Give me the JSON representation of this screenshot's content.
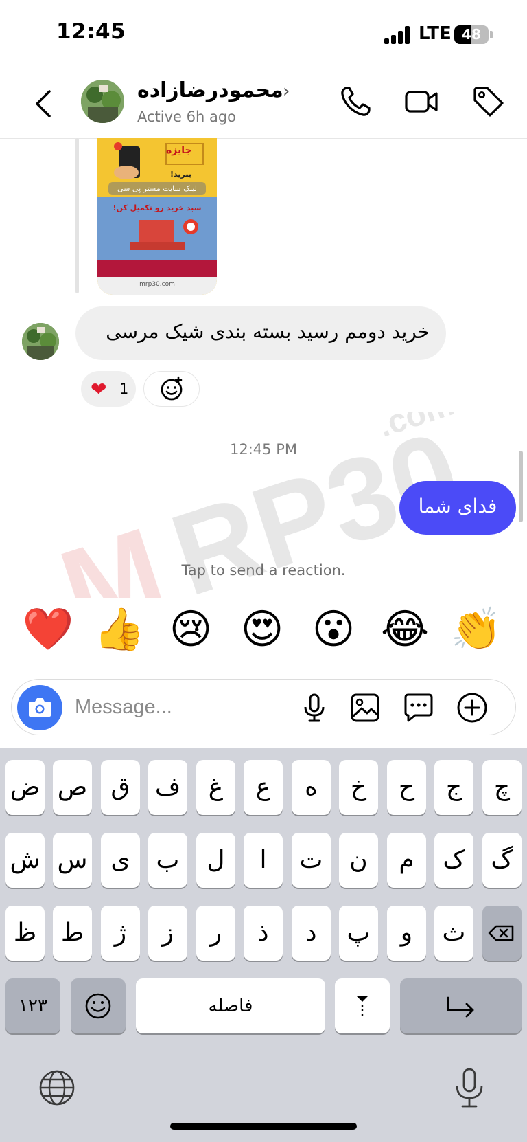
{
  "status_bar": {
    "time": "12:45",
    "network": "LTE",
    "battery": "48",
    "battery_level": 0.48
  },
  "header": {
    "contact_name": "محمودرضازاده",
    "status": "Active 6h ago",
    "icons": [
      "back-icon",
      "phone-icon",
      "video-icon",
      "tag-icon"
    ]
  },
  "shared_image": {
    "prize_title": "جایزه",
    "prize_sub": "ببرید!",
    "link_label": "لینک سایت مستر پی سی",
    "cart_text": "سبد خرید رو تکمیل کن!",
    "url": "mrp30.com"
  },
  "messages": {
    "incoming": "خرید دومم رسید بسته بندی شیک مرسی",
    "reaction_emoji": "❤",
    "reaction_count": "1",
    "timestamp": "12:45 PM",
    "outgoing": "فدای شما"
  },
  "reaction_hint": "Tap to send a reaction.",
  "quick_reactions": [
    "❤️",
    "👍",
    "😢",
    "😍",
    "😮",
    "😂",
    "👏"
  ],
  "composer": {
    "placeholder": "Message..."
  },
  "keyboard": {
    "row1": [
      "ض",
      "ص",
      "ق",
      "ف",
      "غ",
      "ع",
      "ه",
      "خ",
      "ح",
      "ج",
      "چ"
    ],
    "row2": [
      "ش",
      "س",
      "ی",
      "ب",
      "ل",
      "ا",
      "ت",
      "ن",
      "م",
      "ک",
      "گ"
    ],
    "row3": [
      "ظ",
      "ط",
      "ژ",
      "ز",
      "ر",
      "ذ",
      "د",
      "پ",
      "و",
      "ث"
    ],
    "numbers_key": "۱۲۳",
    "space_key": "فاصله"
  },
  "colors": {
    "accent": "#4b4bf7",
    "camera": "#3e76f3",
    "heart": "#e0192d",
    "watermark": "#e8a0a0"
  }
}
